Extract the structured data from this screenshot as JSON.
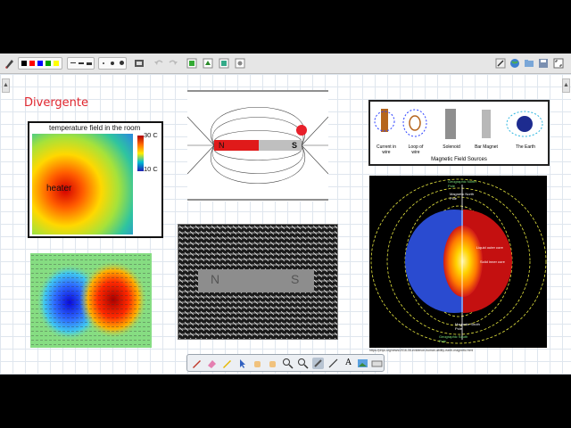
{
  "page": {
    "title": "Divergente"
  },
  "figures": {
    "temperature": {
      "title": "temperature field in the room",
      "label": "heater",
      "scale_max": "30 C",
      "scale_min": "10 C"
    },
    "magnet_lines": {
      "pole_n": "N",
      "pole_s": "S"
    },
    "iron_filings": {
      "pole_n": "N",
      "pole_s": "S"
    },
    "field_sources": {
      "caption": "Magnetic Field Sources",
      "items": [
        "Current in wire",
        "Loop of wire",
        "Solenoid",
        "Bar Magnet",
        "The Earth"
      ]
    },
    "earth": {
      "labels": {
        "geo_north": "Geographic North Pole",
        "mag_north": "Magnetic North Pole",
        "liquid_core": "Liquid outer core",
        "solid_core": "Solid inner core",
        "mag_south": "Magnetic South Pole",
        "geo_south": "Geographic South Pole"
      },
      "source_url": "https://phys.org/news/2016-06-evidence-human-ability-earth-magnetic.html"
    }
  },
  "toolbar": {
    "colors": [
      "#000000",
      "#ff0000",
      "#0000ff",
      "#00a000",
      "#ffff00"
    ],
    "icons": [
      "pen-icon",
      "colors-group",
      "line-style-group",
      "dot-size-group",
      "screen-icon",
      "undo-icon",
      "redo-icon",
      "insert-page-icon",
      "export-icon",
      "import-icon",
      "present-icon",
      "edit-icon",
      "globe-icon",
      "folder-icon",
      "save-icon",
      "fullscreen-icon"
    ]
  },
  "bottom_tools": [
    "pen-tool-icon",
    "eraser-tool-icon",
    "highlighter-tool-icon",
    "pointer-tool-icon",
    "hand-tool-icon",
    "hand-alt-tool-icon",
    "zoom-in-icon",
    "zoom-out-icon",
    "laser-tool-icon",
    "line-tool-icon",
    "text-tool-icon",
    "image-tool-icon",
    "keyboard-icon"
  ]
}
